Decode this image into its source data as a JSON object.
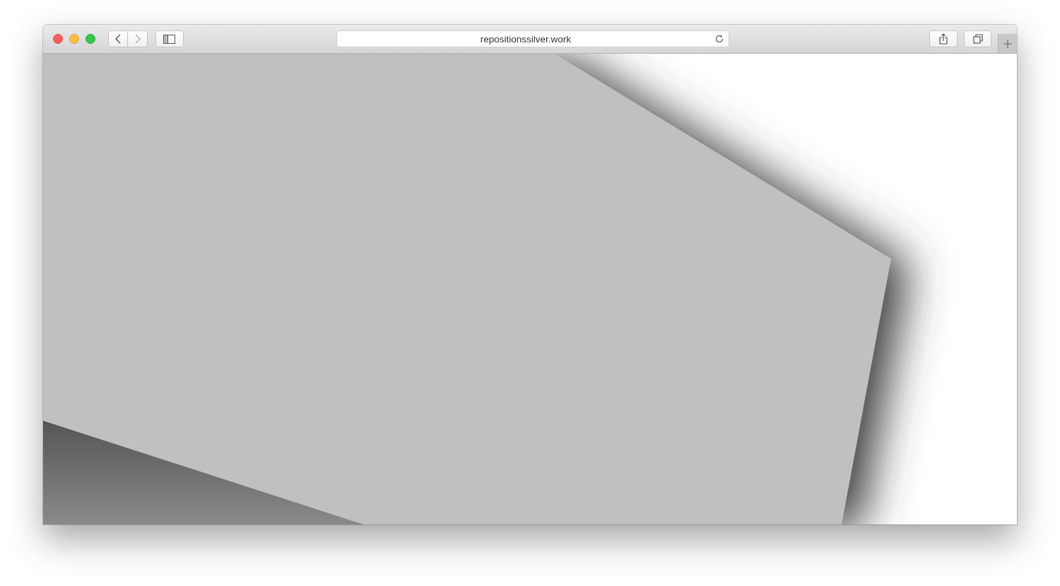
{
  "window": {
    "address": "repositionssilver.work"
  }
}
